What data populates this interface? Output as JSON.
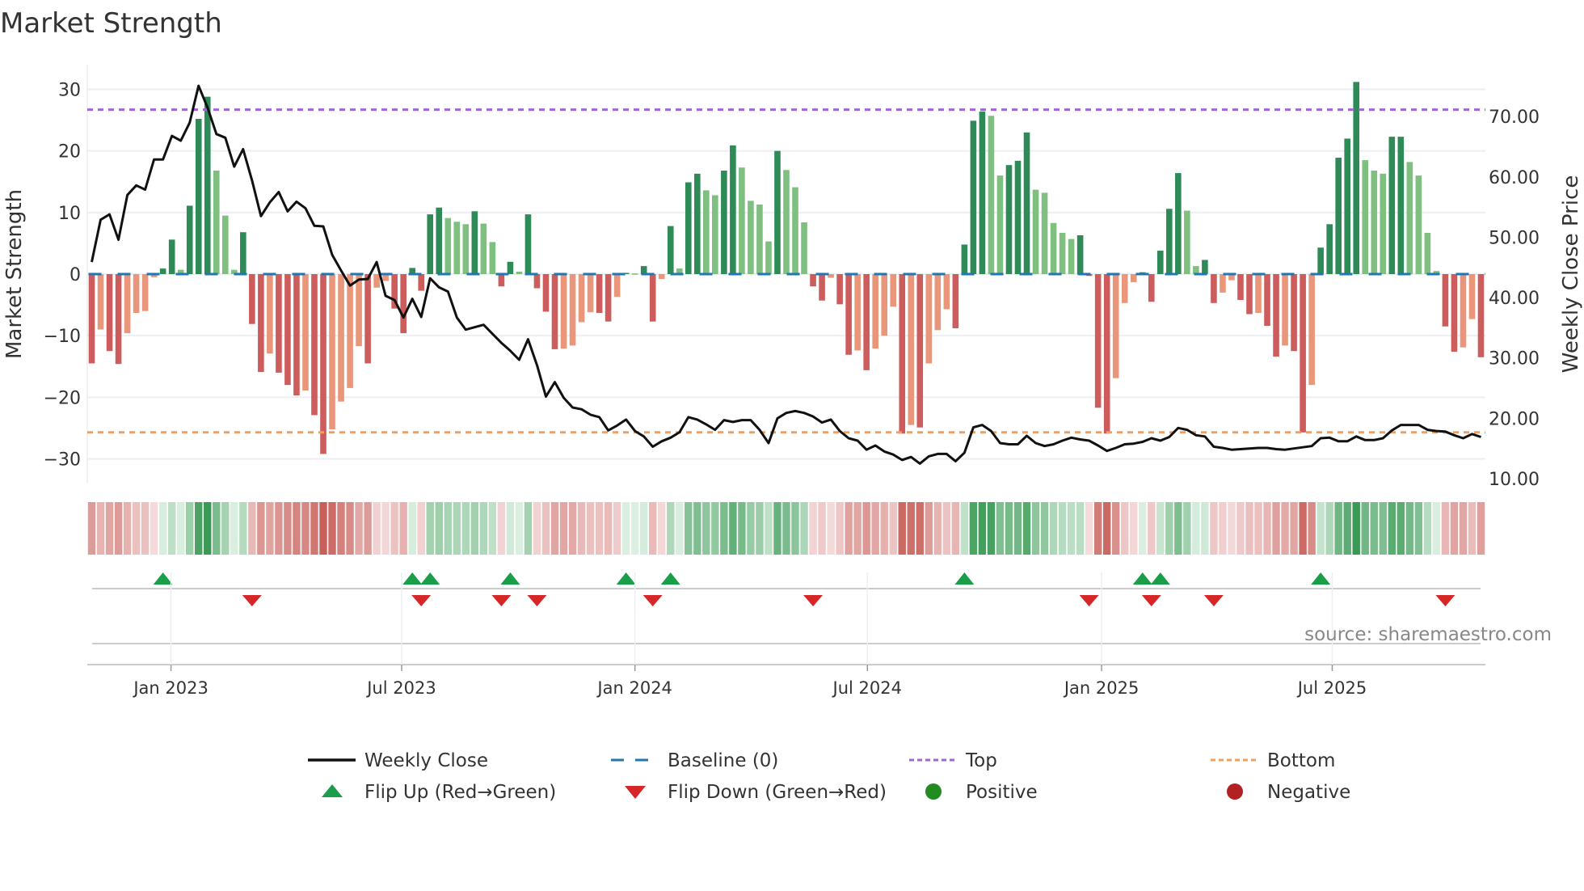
{
  "chart_data": {
    "type": "bar",
    "title": "Market Strength",
    "ylabel": "Market Strength",
    "y2label": "Weekly Close Price",
    "ylim": [
      -34,
      34
    ],
    "y2lim": [
      9.2,
      78.6
    ],
    "yticks": [
      -30,
      -20,
      -10,
      0,
      10,
      20,
      30
    ],
    "y2ticks": [
      "10.00",
      "20.00",
      "30.00",
      "40.00",
      "50.00",
      "60.00",
      "70.00"
    ],
    "x_ticks": [
      {
        "label": "Jan 2023",
        "week": 9.9
      },
      {
        "label": "Jul 2023",
        "week": 35.8
      },
      {
        "label": "Jan 2024",
        "week": 62
      },
      {
        "label": "Jul 2024",
        "week": 88.1
      },
      {
        "label": "Jan 2025",
        "week": 114.4
      },
      {
        "label": "Jul 2025",
        "week": 140.3
      }
    ],
    "top_level": 26.7,
    "bottom_level": -25.7,
    "baseline": 0,
    "strength": [
      -14.5,
      -9,
      -12.5,
      -14.6,
      -9.6,
      -6.3,
      -6,
      -0.5,
      0.9,
      5.6,
      0.7,
      11.1,
      25.2,
      28.8,
      16.8,
      9.5,
      0.7,
      6.8,
      -8.1,
      -15.9,
      -12.9,
      -16,
      -18,
      -19.7,
      -18.9,
      -22.9,
      -29.2,
      -25.2,
      -20.7,
      -18.5,
      -11.7,
      -14.5,
      -2.2,
      -1.1,
      -5.6,
      -9.6,
      1.0,
      -2.7,
      9.7,
      10.8,
      9.1,
      8.5,
      8.1,
      10.2,
      8.2,
      5.2,
      -2.0,
      2.0,
      0.4,
      9.7,
      -2.3,
      -6.1,
      -12.2,
      -12.1,
      -11.6,
      -7.8,
      -6.2,
      -6.3,
      -7.7,
      -3.7,
      0.2,
      0.1,
      1.3,
      -7.7,
      -0.8,
      7.8,
      0.9,
      14.9,
      16.3,
      13.6,
      12.8,
      16.8,
      20.9,
      17.3,
      11.9,
      11.3,
      5.3,
      20,
      16.9,
      14.1,
      8.4,
      -2.0,
      -4.3,
      -0.6,
      -4.9,
      -13.1,
      -12.4,
      -15.6,
      -12.1,
      -10,
      -5.3,
      -25.9,
      -24.5,
      -24.9,
      -14.5,
      -9.1,
      -5.7,
      -8.8,
      4.8,
      24.9,
      26.4,
      25.7,
      16,
      17.7,
      18.4,
      23,
      13.7,
      13.2,
      8.3,
      6.7,
      5.7,
      6.3,
      -0.3,
      -21.7,
      -25.9,
      -16.9,
      -4.7,
      -1.3,
      0.3,
      -4.5,
      3.8,
      10.6,
      16.4,
      10.3,
      1.3,
      2.3,
      -4.7,
      -3.0,
      -1.0,
      -4.2,
      -6.5,
      -6.3,
      -8.4,
      -13.4,
      -11.6,
      -12.5,
      -25.7,
      -18,
      4.3,
      8.1,
      18.9,
      22,
      31.2,
      18.5,
      16.8,
      16.3,
      22.3,
      22.3,
      18.2,
      16,
      6.7,
      0.5,
      -8.5,
      -12.6,
      -11.9,
      -7.3,
      -13.5
    ],
    "weekly_close": [
      45.9,
      52.9,
      53.8,
      49.6,
      57.0,
      58.6,
      57.9,
      62.9,
      62.9,
      66.8,
      66.0,
      69.0,
      75.1,
      71.5,
      67.1,
      66.5,
      61.7,
      64.6,
      59.4,
      53.5,
      55.8,
      57.5,
      54.3,
      55.9,
      54.8,
      51.9,
      51.8,
      47.1,
      44.5,
      42.0,
      43.0,
      43.1,
      45.9,
      40.3,
      39.6,
      36.7,
      39.8,
      36.8,
      43.2,
      41.7,
      41.0,
      36.7,
      34.7,
      35.1,
      35.5,
      34.0,
      32.5,
      31.2,
      29.7,
      33.1,
      28.8,
      23.6,
      26.0,
      23.4,
      21.8,
      21.5,
      20.6,
      20.2,
      18.0,
      18.8,
      19.8,
      17.9,
      17.0,
      15.3,
      16.2,
      16.8,
      17.7,
      20.2,
      19.8,
      19.0,
      18.1,
      19.7,
      19.4,
      19.7,
      19.7,
      18.1,
      15.9,
      20.0,
      20.9,
      21.2,
      20.9,
      20.3,
      19.3,
      19.8,
      17.9,
      16.7,
      16.3,
      14.8,
      15.5,
      14.5,
      14.0,
      13.1,
      13.6,
      12.5,
      13.7,
      14.1,
      14.1,
      12.9,
      14.3,
      18.5,
      18.9,
      17.9,
      15.9,
      15.7,
      15.7,
      17.1,
      15.9,
      15.4,
      15.7,
      16.3,
      16.8,
      16.5,
      16.3,
      15.5,
      14.6,
      15.1,
      15.7,
      15.8,
      16.1,
      16.7,
      16.3,
      16.9,
      18.4,
      18.1,
      17.2,
      17.0,
      15.3,
      15.1,
      14.8,
      14.9,
      15.0,
      15.1,
      15.1,
      14.9,
      14.8,
      15.0,
      15.2,
      15.4,
      16.7,
      16.8,
      16.2,
      16.2,
      17.0,
      16.4,
      16.4,
      16.7,
      18.0,
      18.9,
      18.9,
      18.9,
      18.1,
      17.9,
      17.8,
      17.2,
      16.7,
      17.4,
      16.9
    ],
    "flip_up_weeks": [
      9,
      37,
      39,
      48,
      61,
      66,
      99,
      119,
      121,
      139
    ],
    "flip_down_weeks": [
      19,
      38,
      47,
      51,
      64,
      82,
      113,
      120,
      127,
      153
    ],
    "legend": [
      {
        "label": "Weekly Close",
        "kind": "line",
        "color": "#111111"
      },
      {
        "label": "Baseline (0)",
        "kind": "dash",
        "color": "#1f77b4"
      },
      {
        "label": "Top",
        "kind": "dot",
        "color": "#a066d3"
      },
      {
        "label": "Bottom",
        "kind": "dot",
        "color": "#f0a05a"
      },
      {
        "label": "Flip Up (Red→Green)",
        "kind": "tri-up",
        "color": "#1a9e4a"
      },
      {
        "label": "Flip Down (Green→Red)",
        "kind": "tri-down",
        "color": "#d62728"
      },
      {
        "label": "Positive",
        "kind": "circle",
        "color": "#228b22"
      },
      {
        "label": "Negative",
        "kind": "circle",
        "color": "#b22222"
      }
    ],
    "legend_placement": "bottom",
    "colors": {
      "pos_up": "#2e8b57",
      "pos_down": "#7fbf7f",
      "neg_down": "#cd5c5c",
      "neg_up": "#e9967a"
    },
    "source": "source: sharemaestro.com"
  }
}
